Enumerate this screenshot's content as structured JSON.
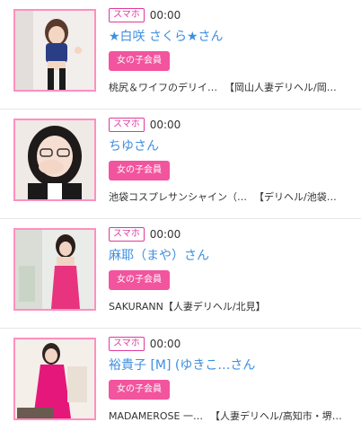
{
  "entries": [
    {
      "device": "スマホ",
      "time": "00:00",
      "name": "★白咲 さくら★さん",
      "member": "女の子会員",
      "shop_name": "桃尻＆ワイフのデリイ…",
      "shop_tag": "【岡山人妻デリヘル/岡…",
      "photo": "woman-blue-outfit-photo",
      "accent": "#3d8fe0"
    },
    {
      "device": "スマホ",
      "time": "00:00",
      "name": "ちゆさん",
      "member": "女の子会員",
      "shop_name": "池袋コスプレサンシャイン（…",
      "shop_tag": "【デリヘル/池袋…",
      "photo": "woman-glasses-photo",
      "accent": "#3d8fe0"
    },
    {
      "device": "スマホ",
      "time": "00:00",
      "name": "麻耶（まや）さん",
      "member": "女の子会員",
      "shop_name": "SAKURANN",
      "shop_tag": "【人妻デリヘル/北見】",
      "photo": "woman-pink-dress-photo",
      "accent": "#3d8fe0"
    },
    {
      "device": "スマホ",
      "time": "00:00",
      "name": "裕貴子 [M] (ゆきこ…さん",
      "member": "女の子会員",
      "shop_name": "MADAMEROSE 一…",
      "shop_tag": "【人妻デリヘル/高知市・堺…",
      "photo": "woman-magenta-dress-photo",
      "accent": "#3d8fe0"
    }
  ],
  "colors": {
    "pink_border": "#ff8fbf",
    "device_badge": "#e0399a",
    "member_badge": "#f2549e",
    "name_link": "#3d8fe0"
  }
}
